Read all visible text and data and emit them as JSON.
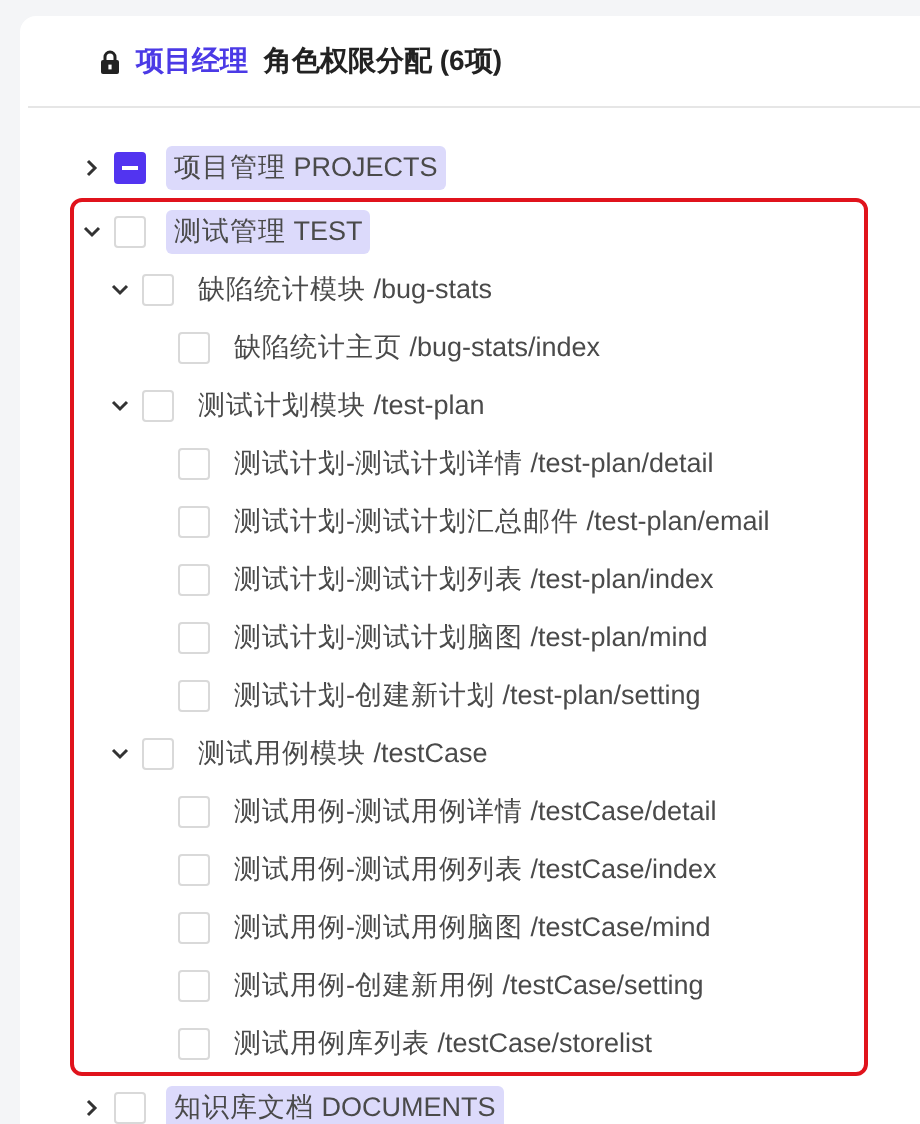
{
  "header": {
    "role": "项目经理",
    "title": "角色权限分配 (6项)"
  },
  "tree": [
    {
      "label": "项目管理 PROJECTS",
      "indeterminate": true,
      "expanded": false,
      "annotated": false
    },
    {
      "label": "测试管理 TEST",
      "checked": false,
      "indeterminate": false,
      "expanded": true,
      "annotated": true,
      "children": [
        {
          "label": "缺陷统计模块 /bug-stats",
          "checked": false,
          "expanded": true,
          "children": [
            {
              "label": "缺陷统计主页 /bug-stats/index",
              "checked": false
            }
          ]
        },
        {
          "label": "测试计划模块 /test-plan",
          "checked": false,
          "expanded": true,
          "children": [
            {
              "label": "测试计划-测试计划详情 /test-plan/detail",
              "checked": false
            },
            {
              "label": "测试计划-测试计划汇总邮件 /test-plan/email",
              "checked": false
            },
            {
              "label": "测试计划-测试计划列表 /test-plan/index",
              "checked": false
            },
            {
              "label": "测试计划-测试计划脑图 /test-plan/mind",
              "checked": false
            },
            {
              "label": "测试计划-创建新计划 /test-plan/setting",
              "checked": false
            }
          ]
        },
        {
          "label": "测试用例模块 /testCase",
          "checked": false,
          "expanded": true,
          "children": [
            {
              "label": "测试用例-测试用例详情 /testCase/detail",
              "checked": false
            },
            {
              "label": "测试用例-测试用例列表 /testCase/index",
              "checked": false
            },
            {
              "label": "测试用例-测试用例脑图 /testCase/mind",
              "checked": false
            },
            {
              "label": "测试用例-创建新用例 /testCase/setting",
              "checked": false
            },
            {
              "label": "测试用例库列表 /testCase/storelist",
              "checked": false
            }
          ]
        }
      ]
    },
    {
      "label": "知识库文档 DOCUMENTS",
      "checked": false,
      "indeterminate": false,
      "expanded": false,
      "annotated": false
    }
  ]
}
